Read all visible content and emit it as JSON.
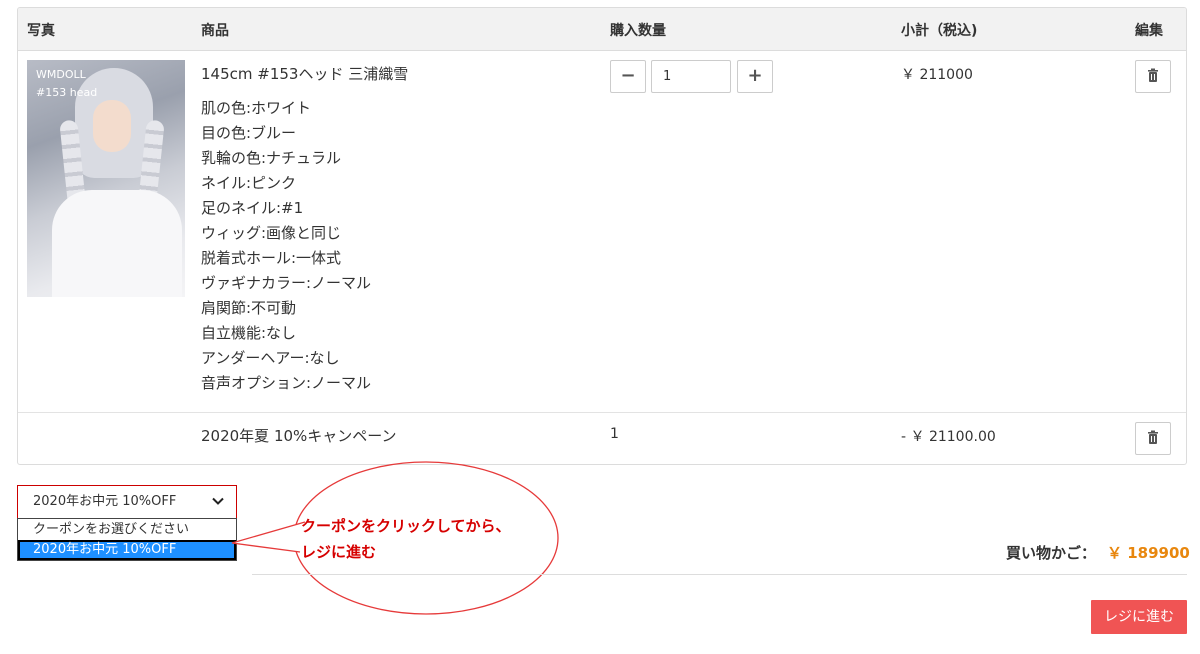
{
  "header": {
    "photo": "写真",
    "product": "商品",
    "quantity": "購入数量",
    "subtotal": "小計（税込)",
    "edit": "編集"
  },
  "item": {
    "photo_caption_1": "WMDOLL",
    "photo_caption_2": "#153 head",
    "name": "145cm #153ヘッド 三浦織雪",
    "options": [
      "肌の色:ホワイト",
      "目の色:ブルー",
      "乳輪の色:ナチュラル",
      "ネイル:ピンク",
      "足のネイル:#1",
      "ウィッグ:画像と同じ",
      "脱着式ホール:一体式",
      "ヴァギナカラー:ノーマル",
      "肩関節:不可動",
      "自立機能:なし",
      "アンダーヘアー:なし",
      "音声オプション:ノーマル"
    ],
    "quantity": "1",
    "minus": "−",
    "plus": "+",
    "price": "￥ 211000"
  },
  "campaign": {
    "name": "2020年夏 10%キャンペーン",
    "quantity": "1",
    "price": "- ￥ 21100.00"
  },
  "coupon": {
    "selected": "2020年お中元 10%OFF",
    "options": [
      "クーポンをお選びください",
      "2020年お中元 10%OFF"
    ]
  },
  "annotation": {
    "line1": "クーポンをクリックしてから、",
    "line2": "レジに進む",
    "color": "#d60000"
  },
  "summary": {
    "label": "買い物かご：",
    "value": "￥ 189900"
  },
  "checkout_label": "レジに進む",
  "colors": {
    "accent_orange": "#e8870e",
    "checkout_red": "#f05454",
    "dropdown_highlight": "#1e90ff"
  }
}
